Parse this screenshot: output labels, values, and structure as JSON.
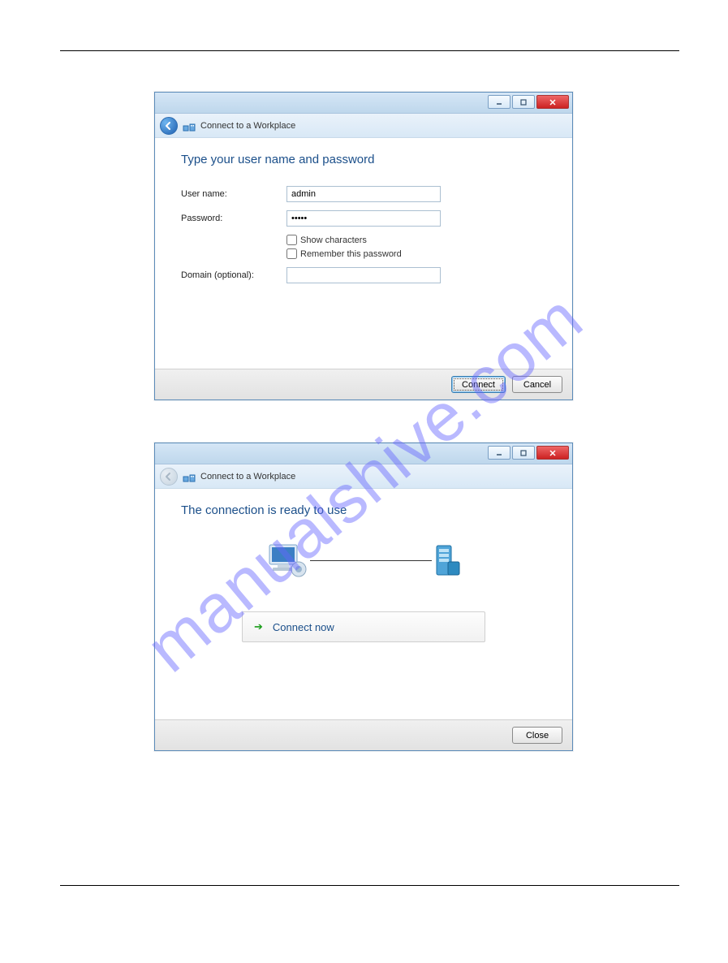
{
  "watermark": "manualshive.com",
  "dialog1": {
    "nav_title": "Connect to a Workplace",
    "heading": "Type your user name and password",
    "username_label": "User name:",
    "username_value": "admin",
    "password_label": "Password:",
    "password_value": "•••••",
    "show_chars_label": "Show characters",
    "remember_label": "Remember this password",
    "domain_label": "Domain (optional):",
    "domain_value": "",
    "connect_btn": "Connect",
    "cancel_btn": "Cancel"
  },
  "dialog2": {
    "nav_title": "Connect to a Workplace",
    "heading": "The connection is ready to use",
    "connect_now_btn": "Connect now",
    "close_btn": "Close"
  }
}
